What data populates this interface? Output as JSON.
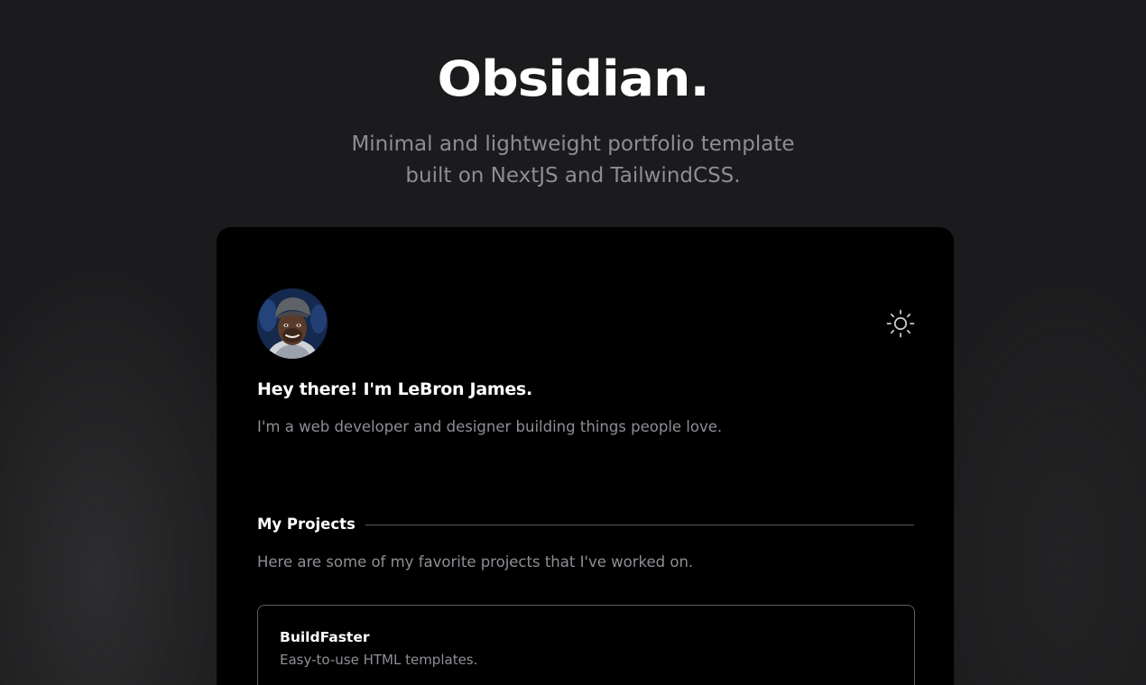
{
  "header": {
    "logo": "Obsidian.",
    "tagline_line1": "Minimal and lightweight portfolio template",
    "tagline_line2": "built on NextJS and TailwindCSS."
  },
  "profile": {
    "avatar_icon": "avatar-photo",
    "greeting": "Hey there! I'm LeBron James.",
    "intro": "I'm a web developer and designer building things people love."
  },
  "theme_toggle": {
    "icon": "sun-icon"
  },
  "projects": {
    "title": "My Projects",
    "description": "Here are some of my favorite projects that I've worked on.",
    "items": [
      {
        "name": "BuildFaster",
        "description": "Easy-to-use HTML templates."
      }
    ]
  },
  "colors": {
    "page_background": "#1b1b1d",
    "card_background": "#000000",
    "heading_text": "#ffffff",
    "muted_text": "#8e8e95",
    "border": "#5e5e63"
  }
}
